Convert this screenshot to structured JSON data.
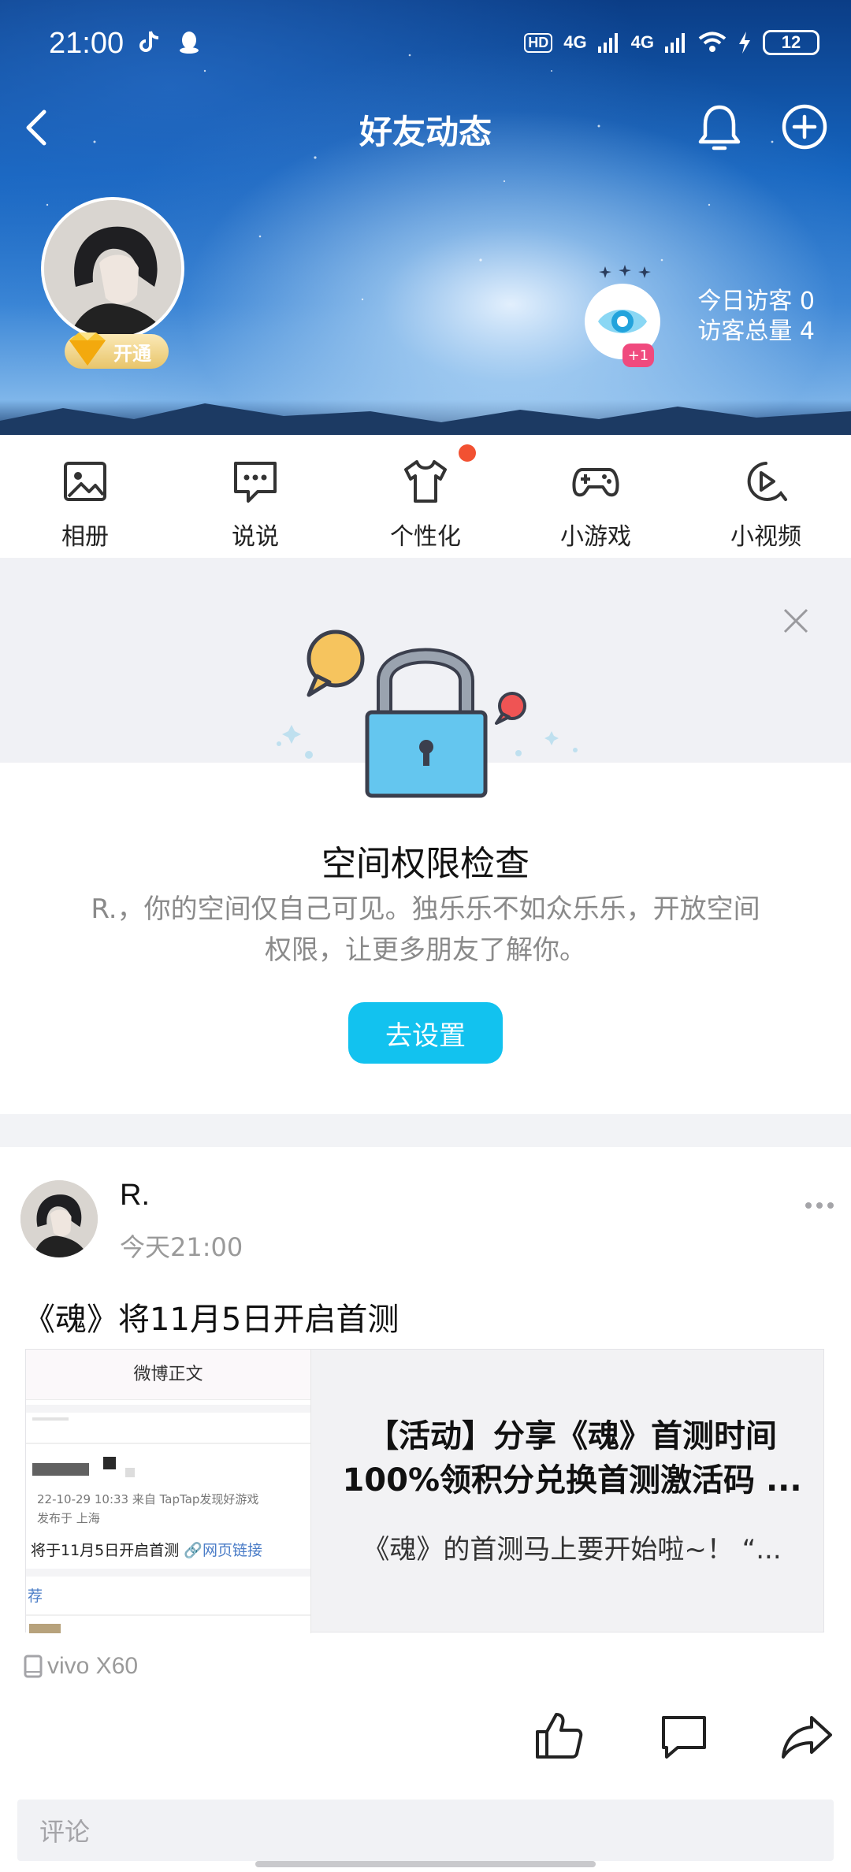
{
  "status_bar": {
    "time": "21:00",
    "network_1": "4G",
    "network_2": "4G",
    "hd_label": "HD",
    "battery": "12"
  },
  "header": {
    "title": "好友动态",
    "vip_label": "开通",
    "visitor_plus": "+1",
    "today_visitors": "今日访客 0",
    "total_visitors": "访客总量 4"
  },
  "quick_nav": [
    {
      "label": "相册"
    },
    {
      "label": "说说"
    },
    {
      "label": "个性化"
    },
    {
      "label": "小游戏"
    },
    {
      "label": "小视频"
    }
  ],
  "permission_card": {
    "title": "空间权限检查",
    "description": "R.，你的空间仅自己可见。独乐乐不如众乐乐，开放空间权限，让更多朋友了解你。",
    "button": "去设置"
  },
  "post": {
    "user": "R.",
    "time": "今天21:00",
    "text": "《魂》将11月5日开启首测",
    "link_card": {
      "thumb_header": "微博正文",
      "thumb_meta_1": "22-10-29 10:33  来自 TapTap发现好游戏",
      "thumb_meta_2": "发布于 上海",
      "thumb_line": "将于11月5日开启首测",
      "thumb_link": "网页链接",
      "thumb_rec": "荐",
      "title": "【活动】分享《魂》首测时间100%领积分兑换首测激活码 ...",
      "description": "《魂》的首测马上要开始啦~！  “..."
    },
    "device": "vivo X60",
    "comment_placeholder": "评论"
  },
  "colors": {
    "accent": "#12c2ef",
    "badge_red": "#f25132",
    "visitor_pink": "#f04a7e"
  }
}
